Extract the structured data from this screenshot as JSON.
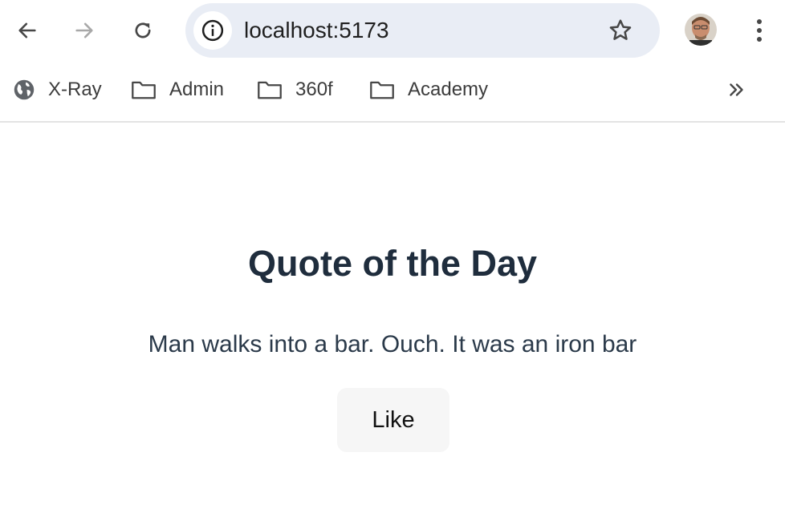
{
  "browser": {
    "url": "localhost:5173",
    "bookmarks": [
      {
        "label": "X-Ray",
        "icon": "globe-icon"
      },
      {
        "label": "Admin",
        "icon": "folder-icon"
      },
      {
        "label": "360f",
        "icon": "folder-icon"
      },
      {
        "label": "Academy",
        "icon": "folder-icon"
      }
    ],
    "overflow_label": "»"
  },
  "page": {
    "title": "Quote of the Day",
    "quote": "Man walks into a bar. Ouch. It was an iron bar",
    "like_label": "Like"
  },
  "colors": {
    "omnibox_bg": "#e9edf5",
    "title": "#1f2d3d",
    "button_bg": "#f6f6f6"
  }
}
